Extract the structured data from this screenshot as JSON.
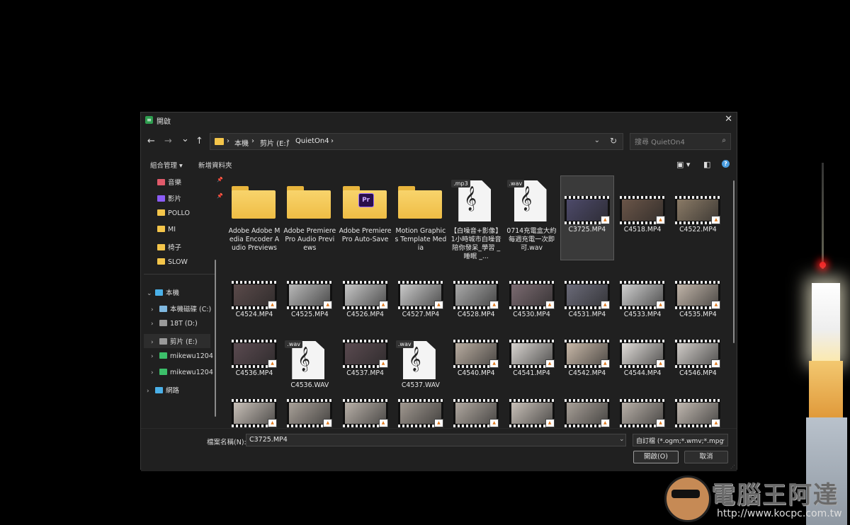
{
  "dialog": {
    "title": "開啟",
    "close": "✕"
  },
  "nav": {
    "back": "←",
    "forward": "→",
    "recent": "⌄",
    "up": "↑",
    "breadcrumb": [
      "本機",
      "剪片 (E:)",
      "QuietOn4"
    ],
    "separator": "›",
    "refresh": "↻",
    "dropdown": "⌄"
  },
  "search": {
    "placeholder": "搜尋 QuietOn4",
    "icon": "⌕"
  },
  "command_bar": {
    "organize": "組合管理 ▾",
    "new_folder": "新增資料夾",
    "help": "?"
  },
  "sidebar": {
    "quick": [
      {
        "label": "音樂",
        "icon": "music-icon",
        "color": "#e05a6a",
        "pinned": true
      },
      {
        "label": "影片",
        "icon": "video-icon",
        "color": "#8b5cf6",
        "pinned": true
      },
      {
        "label": "POLLO",
        "icon": "folder-icon",
        "color": "#f4c54a",
        "pinned": false
      },
      {
        "label": "MI",
        "icon": "folder-icon",
        "color": "#f4c54a",
        "pinned": false
      },
      {
        "label": "椅子",
        "icon": "folder-icon",
        "color": "#f4c54a",
        "pinned": false
      },
      {
        "label": "SLOW",
        "icon": "folder-icon",
        "color": "#f4c54a",
        "pinned": false
      }
    ],
    "tree": [
      {
        "label": "本機",
        "icon": "pc-icon",
        "color": "#4ab0e8",
        "expanded": true,
        "indent": 0
      },
      {
        "label": "本機磁碟 (C:)",
        "icon": "drive-icon",
        "color": "#7fb8e0",
        "expanded": false,
        "indent": 1
      },
      {
        "label": "18T (D:)",
        "icon": "drive-icon",
        "color": "#9a9a9a",
        "expanded": false,
        "indent": 1
      },
      {
        "label": "剪片 (E:)",
        "icon": "drive-icon",
        "color": "#9a9a9a",
        "expanded": false,
        "indent": 1,
        "selected": true
      },
      {
        "label": "mikewu1204",
        "icon": "network-drive-icon",
        "color": "#3cbf6a",
        "expanded": false,
        "indent": 1
      },
      {
        "label": "mikewu1204",
        "icon": "network-drive-icon",
        "color": "#3cbf6a",
        "expanded": false,
        "indent": 1
      },
      {
        "label": "網路",
        "icon": "network-icon",
        "color": "#4ab0e8",
        "expanded": false,
        "indent": 0
      }
    ]
  },
  "files": [
    {
      "name": "Adobe Adobe Media Encoder Audio Previews",
      "kind": "folder"
    },
    {
      "name": "Adobe Premiere Pro Audio Previews",
      "kind": "folder"
    },
    {
      "name": "Adobe Premiere Pro Auto-Save",
      "kind": "folder-pr",
      "badge": "Pr"
    },
    {
      "name": "Motion Graphics Template Media",
      "kind": "folder"
    },
    {
      "name": "【白噪音+影像】1小時城市白噪音陪你發呆_學習 _ 睡眠 _...",
      "kind": "audio",
      "ext": ".mp3"
    },
    {
      "name": "0714充電盒大約每週充電一次即可.wav",
      "kind": "audio",
      "ext": ".wav"
    },
    {
      "name": "C3725.MP4",
      "kind": "video",
      "scene": "#4d4a6a",
      "selected": true
    },
    {
      "name": "C4518.MP4",
      "kind": "video",
      "scene": "#6a5548"
    },
    {
      "name": "C4522.MP4",
      "kind": "video",
      "scene": "#8a7a66"
    },
    {
      "name": "C4524.MP4",
      "kind": "video",
      "scene": "#5a4a4a"
    },
    {
      "name": "C4525.MP4",
      "kind": "video",
      "scene": "#b8b8b8"
    },
    {
      "name": "C4526.MP4",
      "kind": "video",
      "scene": "#c6c6c6"
    },
    {
      "name": "C4527.MP4",
      "kind": "video",
      "scene": "#c9c9c9"
    },
    {
      "name": "C4528.MP4",
      "kind": "video",
      "scene": "#a9a9a9"
    },
    {
      "name": "C4530.MP4",
      "kind": "video",
      "scene": "#7a6a70"
    },
    {
      "name": "C4531.MP4",
      "kind": "video",
      "scene": "#6a6a78"
    },
    {
      "name": "C4533.MP4",
      "kind": "video",
      "scene": "#cfcfcf"
    },
    {
      "name": "C4535.MP4",
      "kind": "video",
      "scene": "#c0b4a8"
    },
    {
      "name": "C4536.MP4",
      "kind": "video",
      "scene": "#5a4a50"
    },
    {
      "name": "C4536.WAV",
      "kind": "audio",
      "ext": ".wav"
    },
    {
      "name": "C4537.MP4",
      "kind": "video",
      "scene": "#5a4a50"
    },
    {
      "name": "C4537.WAV",
      "kind": "audio",
      "ext": ".wav"
    },
    {
      "name": "C4540.MP4",
      "kind": "video",
      "scene": "#b8aca0"
    },
    {
      "name": "C4541.MP4",
      "kind": "video",
      "scene": "#d8d4d0"
    },
    {
      "name": "C4542.MP4",
      "kind": "video",
      "scene": "#c8b8a8"
    },
    {
      "name": "C4544.MP4",
      "kind": "video",
      "scene": "#e0dcd8"
    },
    {
      "name": "C4546.MP4",
      "kind": "video",
      "scene": "#d0ccc8"
    },
    {
      "name": "",
      "kind": "video",
      "scene": "#c8c0b8"
    },
    {
      "name": "",
      "kind": "video",
      "scene": "#a8a098"
    },
    {
      "name": "",
      "kind": "video",
      "scene": "#b8b0a8"
    },
    {
      "name": "",
      "kind": "video",
      "scene": "#a09890"
    },
    {
      "name": "",
      "kind": "video",
      "scene": "#b0a8a0"
    },
    {
      "name": "",
      "kind": "video",
      "scene": "#c8c0b8"
    },
    {
      "name": "",
      "kind": "video",
      "scene": "#a8a098"
    },
    {
      "name": "",
      "kind": "video",
      "scene": "#b8b0a8"
    },
    {
      "name": "",
      "kind": "video",
      "scene": "#c0b8b0"
    }
  ],
  "bottom": {
    "filename_label": "檔案名稱(N):",
    "filename_value": "C3725.MP4",
    "filter": "自訂檔 (*.ogm;*.wmv;*.mpg",
    "open": "開啟(O)",
    "cancel": "取消"
  },
  "watermark": {
    "title": "電腦王阿達",
    "url": "http://www.kocpc.com.tw"
  }
}
